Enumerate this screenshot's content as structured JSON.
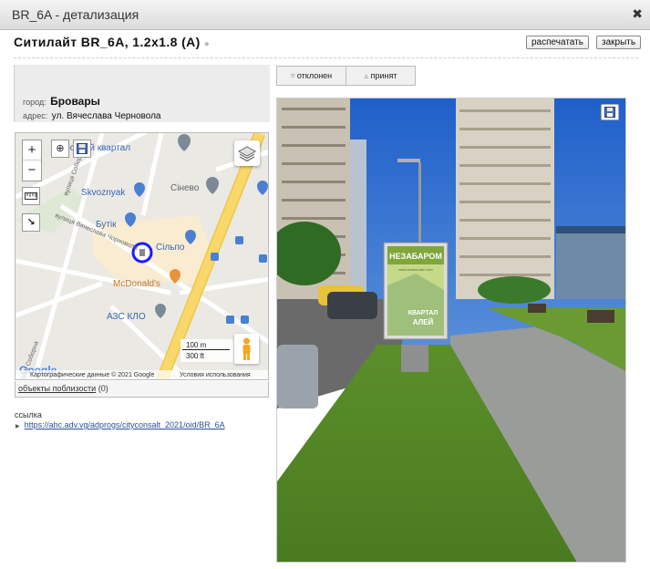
{
  "window": {
    "title": "BR_6A - детализация",
    "close_glyph": "✖"
  },
  "heading": {
    "text": "Ситилайт  BR_6A,  1.2x1.8  (A)",
    "pin_glyph": "📍"
  },
  "actions": {
    "print_label": "распечатать",
    "close_label": "закрыть"
  },
  "info": {
    "city_label": "город:",
    "city_value": "Бровары",
    "address_label": "адрес:",
    "address_value": "ул. Вячеслава Черновола"
  },
  "map": {
    "zoom_in": "+",
    "zoom_out": "−",
    "labels": {
      "quarter": "Лісовий квартал",
      "skvoznyak": "Skvoznyak",
      "sinevo": "Сінево",
      "butik": "Бутік",
      "silpo": "Сільпо",
      "mcdonalds": "McDonald's",
      "azs": "АЗС КЛО",
      "street_sobornaya_1": "вулиця Соборна",
      "street_sobornaya_2": "вулиця Соборна",
      "street_chornovola": "вулиця Вячеслава Чорновола"
    },
    "scale_metric": "100 m",
    "scale_imperial": "300 ft",
    "logo": "Google",
    "attribution": "Картографические данные © 2021 Google",
    "terms": "Условия использования"
  },
  "nearby": {
    "label": "объекты поблизости",
    "count": "(0)"
  },
  "link": {
    "label": "ссылка",
    "url": "https://ahc.adv.vg/adprogs/cityconsalt_2021/oid/BR_6A"
  },
  "feedback": {
    "reject_label": "отклонен",
    "accept_label": "принят"
  },
  "photo": {
    "billboard_top": "НЕЗАБАРОМ",
    "billboard_url": "www.kvartal-alei.com",
    "billboard_brand_1": "КВАРТАЛ",
    "billboard_brand_2": "АЛЕЙ"
  },
  "colors": {
    "accent_blue": "#2a4f9e",
    "marker_blue": "#1a1aff",
    "road_yellow": "#f8d86a"
  }
}
